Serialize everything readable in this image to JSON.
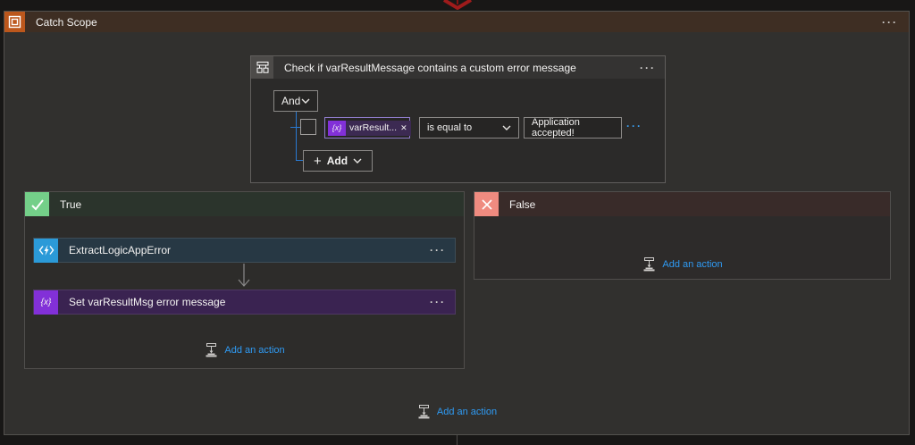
{
  "scope": {
    "title": "Catch Scope",
    "menu": "···"
  },
  "condition": {
    "title": "Check if varResultMessage contains a custom error message",
    "menu": "···",
    "join": "And",
    "row": {
      "token_icon": "{x}",
      "token": "varResult...",
      "token_close": "✕",
      "operator": "is equal to",
      "value": "Application accepted!",
      "menu": "···"
    },
    "add": {
      "plus": "+",
      "label": "Add"
    }
  },
  "true_branch": {
    "label": "True",
    "actions": [
      {
        "title": "ExtractLogicAppError",
        "menu": "···"
      },
      {
        "title": "Set varResultMsg error message",
        "menu": "···",
        "icon": "{x}"
      }
    ],
    "add_action": "Add an action"
  },
  "false_branch": {
    "label": "False",
    "add_action": "Add an action"
  },
  "footer": {
    "add_action": "Add an action"
  },
  "colors": {
    "scope_accent": "#bc571c",
    "condition_header": "#343332",
    "true_accent": "#74cf89",
    "false_accent": "#ef8b80",
    "function_accent": "#2b9ad8",
    "variable_accent": "#8230d8",
    "link_blue": "#2f9bf4",
    "connector_blue": "#2a7ad2",
    "incoming_arrow_red": "#9e1b1b"
  }
}
